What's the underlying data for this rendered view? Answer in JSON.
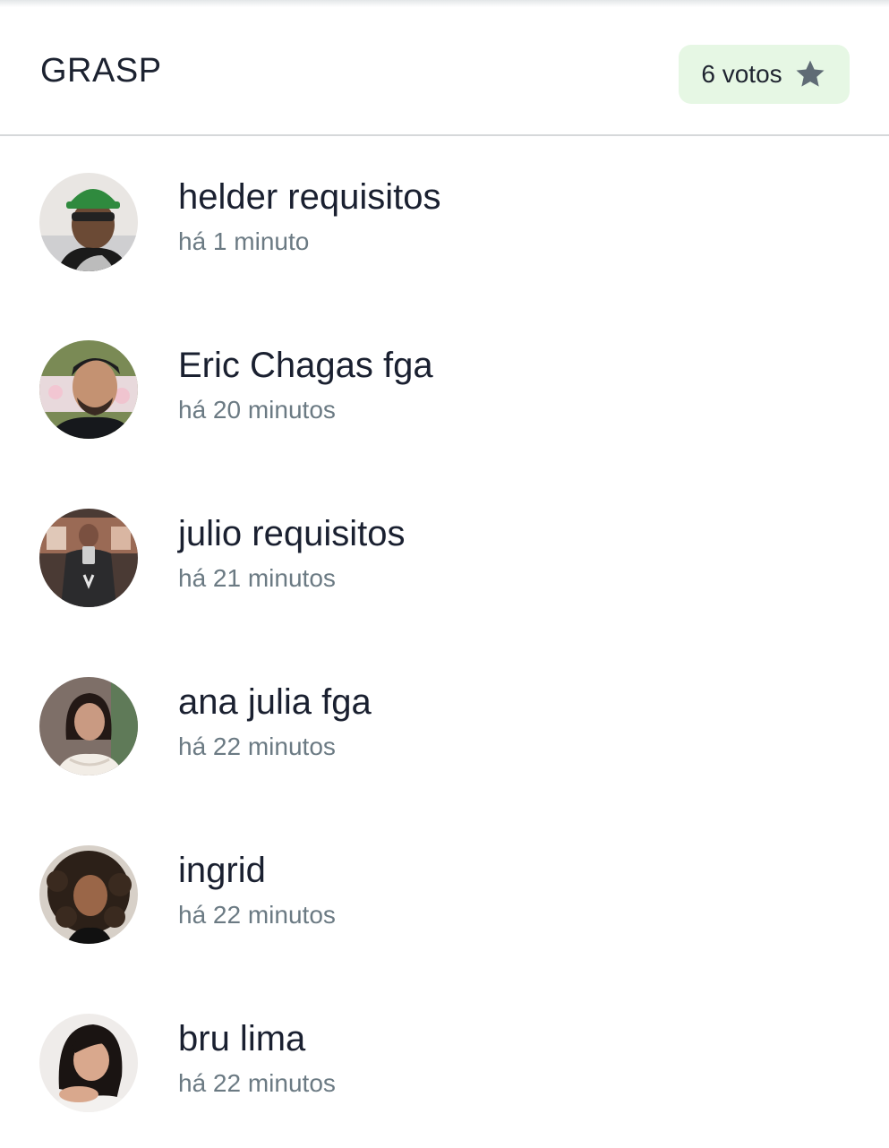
{
  "header": {
    "title": "GRASP",
    "votes_label": "6 votos",
    "votes_icon": "star-icon",
    "badge_color": "#e6f7e4"
  },
  "voters": [
    {
      "name": "helder requisitos",
      "time": "há 1 minuto"
    },
    {
      "name": "Eric Chagas fga",
      "time": "há 20 minutos"
    },
    {
      "name": "julio requisitos",
      "time": "há 21 minutos"
    },
    {
      "name": "ana julia fga",
      "time": "há 22 minutos"
    },
    {
      "name": "ingrid",
      "time": "há 22 minutos"
    },
    {
      "name": "bru lima",
      "time": "há 22 minutos"
    }
  ]
}
